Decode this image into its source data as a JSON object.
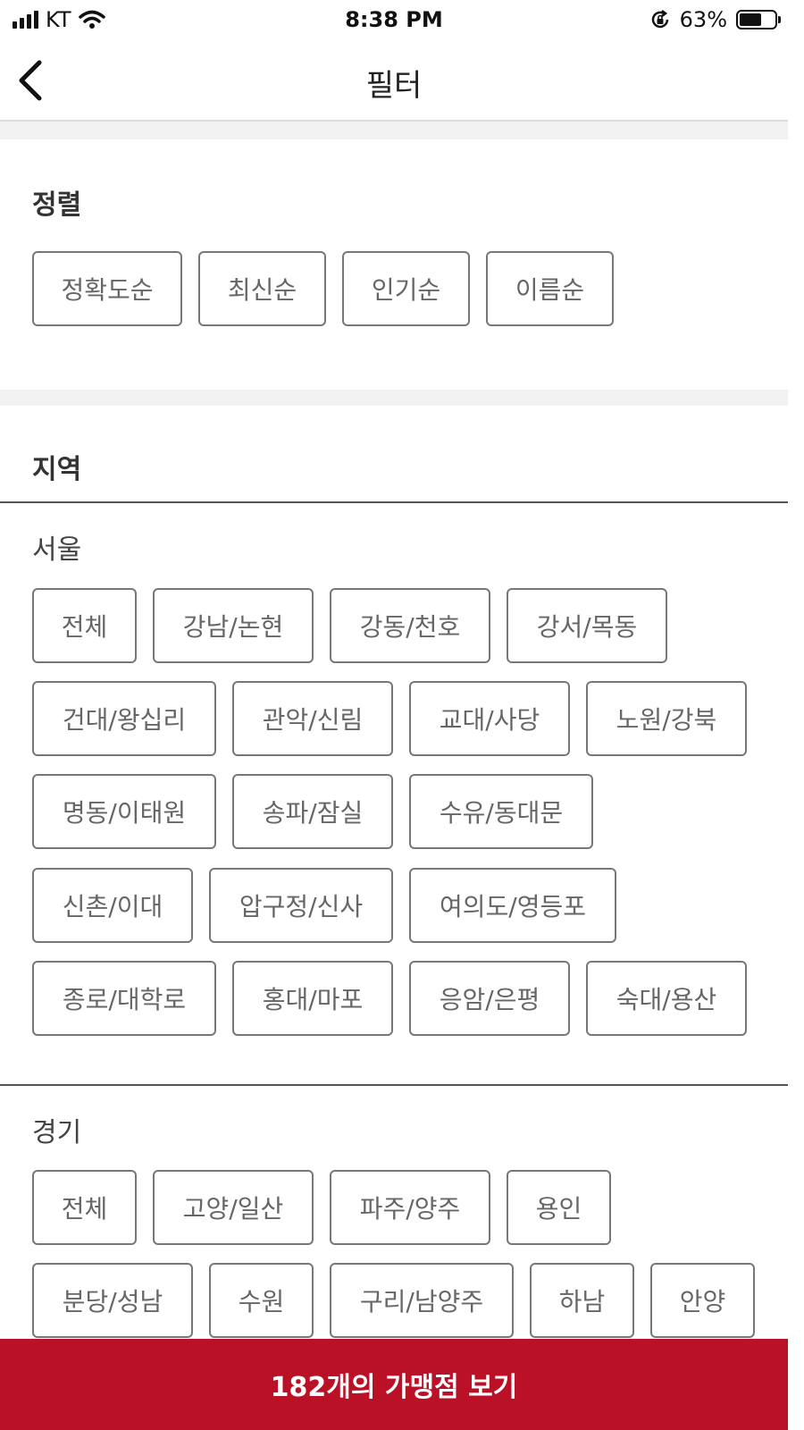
{
  "status_bar": {
    "carrier": "KT",
    "time": "8:38 PM",
    "battery": "63%",
    "battery_level": 0.63,
    "icons": [
      "signal-icon",
      "wifi-icon",
      "orientation-lock-icon",
      "battery-icon"
    ]
  },
  "nav": {
    "back_icon": "chevron-left-icon",
    "title": "필터"
  },
  "sort": {
    "title": "정렬",
    "options": [
      "정확도순",
      "최신순",
      "인기순",
      "이름순"
    ]
  },
  "region": {
    "title": "지역",
    "seoul": {
      "label": "서울",
      "rows": [
        [
          "전체",
          "강남/논현",
          "강동/천호",
          "강서/목동"
        ],
        [
          "건대/왕십리",
          "관악/신림",
          "교대/사당",
          "노원/강북"
        ],
        [
          "명동/이태원",
          "송파/잠실",
          "수유/동대문"
        ],
        [
          "신촌/이대",
          "압구정/신사",
          "여의도/영등포"
        ],
        [
          "종로/대학로",
          "홍대/마포",
          "응암/은평",
          "숙대/용산"
        ]
      ]
    },
    "gyeonggi": {
      "label": "경기",
      "rows": [
        [
          "전체",
          "고양/일산",
          "파주/양주",
          "용인"
        ],
        [
          "분당/성남",
          "수원",
          "구리/남양주",
          "하남",
          "안양"
        ]
      ]
    }
  },
  "cta": {
    "label": "182개의 가맹점 보기",
    "color": "#bb1126"
  }
}
